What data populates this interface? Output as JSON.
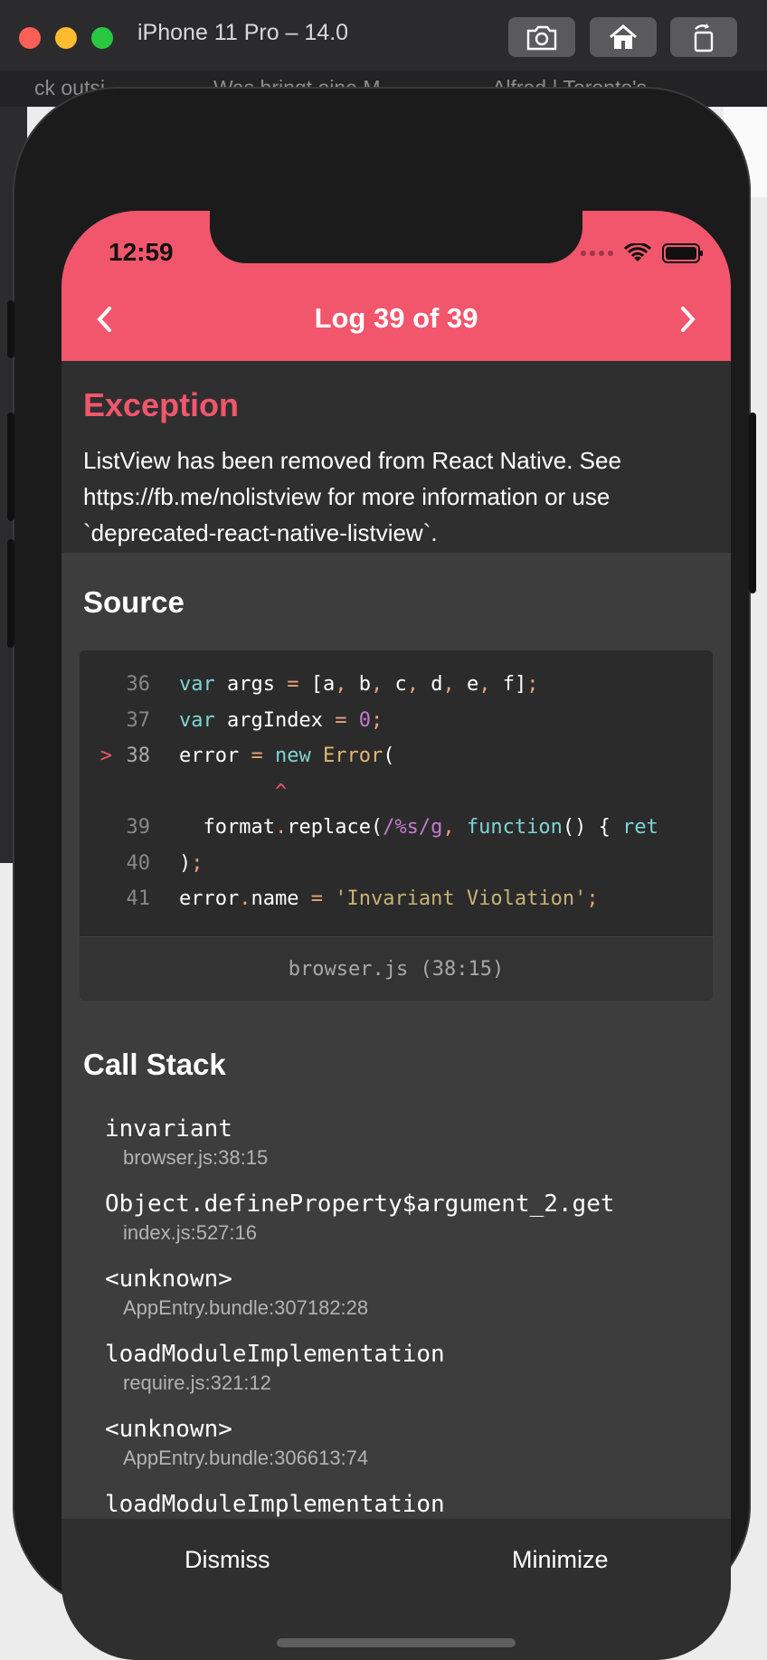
{
  "window": {
    "title": "iPhone 11 Pro – 14.0",
    "toolbar": [
      "camera-icon",
      "home-icon",
      "rotate-icon"
    ]
  },
  "background_tabs": [
    "ck outsi...",
    "Was bringt eine M...",
    "Alfred | Toronto's..."
  ],
  "status_bar": {
    "time": "12:59"
  },
  "nav": {
    "title": "Log 39 of 39",
    "prev_icon": "chevron-left-icon",
    "next_icon": "chevron-right-icon"
  },
  "exception": {
    "title": "Exception",
    "message": "ListView has been removed from React Native. See https://fb.me/nolistview for more information or use `deprecated-react-native-listview`."
  },
  "source": {
    "title": "Source",
    "lines": [
      {
        "num": "36",
        "text": "var args = [a, b, c, d, e, f];"
      },
      {
        "num": "37",
        "text": "var argIndex = 0;"
      },
      {
        "num": "38",
        "text": "error = new Error(",
        "current": true,
        "marker": ">"
      },
      {
        "num": "",
        "text": "        ^"
      },
      {
        "num": "39",
        "text": "  format.replace(/%s/g, function() { ret"
      },
      {
        "num": "40",
        "text": ");"
      },
      {
        "num": "41",
        "text": "error.name = 'Invariant Violation';"
      }
    ],
    "file": "browser.js (38:15)"
  },
  "call_stack": {
    "title": "Call Stack",
    "frames": [
      {
        "fn": "invariant",
        "loc": "browser.js:38:15"
      },
      {
        "fn": "Object.defineProperty$argument_2.get",
        "loc": "index.js:527:16"
      },
      {
        "fn": "<unknown>",
        "loc": "AppEntry.bundle:307182:28"
      },
      {
        "fn": "loadModuleImplementation",
        "loc": "require.js:321:12"
      },
      {
        "fn": "<unknown>",
        "loc": "AppEntry.bundle:306613:74"
      },
      {
        "fn": "loadModuleImplementation",
        "loc": ""
      }
    ]
  },
  "actions": {
    "dismiss": "Dismiss",
    "minimize": "Minimize"
  },
  "colors": {
    "accent": "#f1566c",
    "panel": "#2f2f2f",
    "body": "#3d3d3d"
  }
}
